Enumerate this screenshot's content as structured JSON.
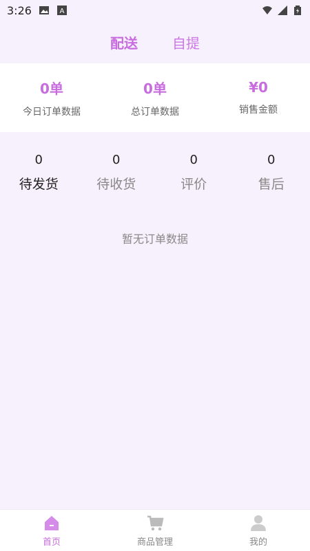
{
  "status_bar": {
    "time": "3:26"
  },
  "top_tabs": [
    {
      "label": "配送",
      "active": true
    },
    {
      "label": "自提",
      "active": false
    }
  ],
  "stats": [
    {
      "value": "0单",
      "label": "今日订单数据"
    },
    {
      "value": "0单",
      "label": "总订单数据"
    },
    {
      "value": "¥0",
      "label": "销售金额"
    }
  ],
  "order_tabs": [
    {
      "count": "0",
      "label": "待发货",
      "active": true
    },
    {
      "count": "0",
      "label": "待收货",
      "active": false
    },
    {
      "count": "0",
      "label": "评价",
      "active": false
    },
    {
      "count": "0",
      "label": "售后",
      "active": false
    }
  ],
  "empty_message": "暂无订单数据",
  "bottom_nav": [
    {
      "label": "首页",
      "icon": "home-icon",
      "active": true
    },
    {
      "label": "商品管理",
      "icon": "cart-icon",
      "active": false
    },
    {
      "label": "我的",
      "icon": "user-icon",
      "active": false
    }
  ],
  "colors": {
    "accent": "#c86dde",
    "background": "#f7f1fd"
  }
}
